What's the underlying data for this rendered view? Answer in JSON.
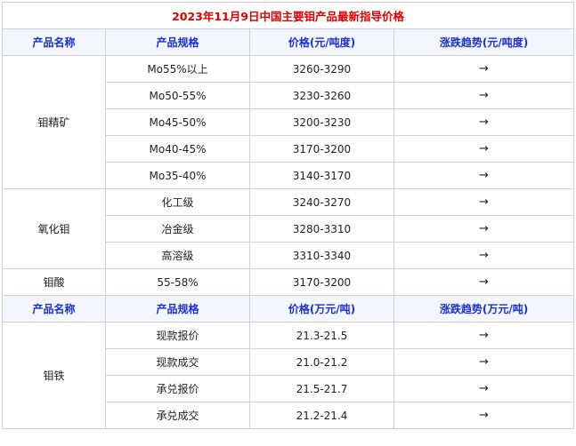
{
  "title": "2023年11月9日中国主要钼产品最新指导价格",
  "header1": {
    "name": "产品名称",
    "spec": "产品规格",
    "price": "价格(元/吨度)",
    "trend": "涨跌趋势(元/吨度)"
  },
  "header2": {
    "name": "产品名称",
    "spec": "产品规格",
    "price": "价格(万元/吨)",
    "trend": "涨跌趋势(万元/吨)"
  },
  "groups": [
    {
      "name": "钼精矿",
      "rows": [
        {
          "spec": "Mo55%以上",
          "price": "3260-3290",
          "trend": "→"
        },
        {
          "spec": "Mo50-55%",
          "price": "3230-3260",
          "trend": "→"
        },
        {
          "spec": "Mo45-50%",
          "price": "3200-3230",
          "trend": "→"
        },
        {
          "spec": "Mo40-45%",
          "price": "3170-3200",
          "trend": "→"
        },
        {
          "spec": "Mo35-40%",
          "price": "3140-3170",
          "trend": "→"
        }
      ]
    },
    {
      "name": "氧化钼",
      "rows": [
        {
          "spec": "化工级",
          "price": "3240-3270",
          "trend": "→"
        },
        {
          "spec": "冶金级",
          "price": "3280-3310",
          "trend": "→"
        },
        {
          "spec": "高溶级",
          "price": "3310-3340",
          "trend": "→"
        }
      ]
    },
    {
      "name": "钼酸",
      "rows": [
        {
          "spec": "55-58%",
          "price": "3170-3200",
          "trend": "→"
        }
      ]
    },
    {
      "name": "钼铁",
      "rows": [
        {
          "spec": "现款报价",
          "price": "21.3-21.5",
          "trend": "→"
        },
        {
          "spec": "现款成交",
          "price": "21.0-21.2",
          "trend": "→"
        },
        {
          "spec": "承兑报价",
          "price": "21.5-21.7",
          "trend": "→"
        },
        {
          "spec": "承兑成交",
          "price": "21.2-21.4",
          "trend": "→"
        }
      ]
    }
  ],
  "colors": {
    "title": "#e00000",
    "header": "#1a2fd6",
    "border": "#d0d0d0"
  }
}
